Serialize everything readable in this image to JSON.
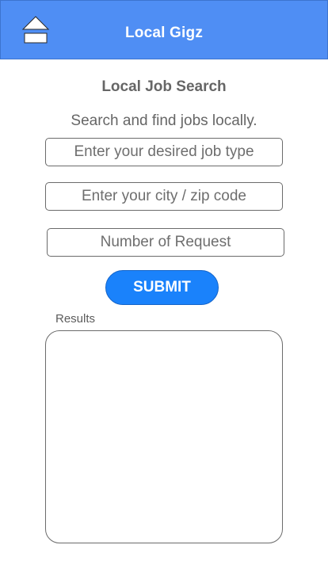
{
  "header": {
    "title": "Local Gigz",
    "home_icon": "home-icon"
  },
  "main": {
    "title": "Local Job Search",
    "subtitle": "Search and find jobs locally.",
    "job_type": {
      "value": "",
      "placeholder": "Enter your desired job type"
    },
    "location": {
      "value": "",
      "placeholder": "Enter your city / zip code"
    },
    "request_count": {
      "value": "",
      "placeholder": "Number of Request"
    },
    "submit_label": "SUBMIT",
    "results_label": "Results"
  },
  "colors": {
    "header_bg": "#4f8ef4",
    "submit_bg": "#1a82fb",
    "text": "#666666"
  }
}
